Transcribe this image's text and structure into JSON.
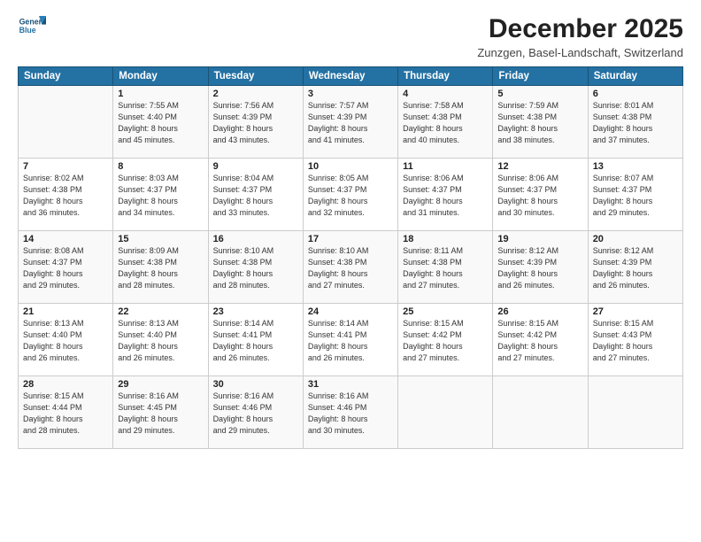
{
  "header": {
    "logo_line1": "General",
    "logo_line2": "Blue",
    "month_title": "December 2025",
    "location": "Zunzgen, Basel-Landschaft, Switzerland"
  },
  "weekdays": [
    "Sunday",
    "Monday",
    "Tuesday",
    "Wednesday",
    "Thursday",
    "Friday",
    "Saturday"
  ],
  "weeks": [
    [
      {
        "day": "",
        "info": ""
      },
      {
        "day": "1",
        "info": "Sunrise: 7:55 AM\nSunset: 4:40 PM\nDaylight: 8 hours\nand 45 minutes."
      },
      {
        "day": "2",
        "info": "Sunrise: 7:56 AM\nSunset: 4:39 PM\nDaylight: 8 hours\nand 43 minutes."
      },
      {
        "day": "3",
        "info": "Sunrise: 7:57 AM\nSunset: 4:39 PM\nDaylight: 8 hours\nand 41 minutes."
      },
      {
        "day": "4",
        "info": "Sunrise: 7:58 AM\nSunset: 4:38 PM\nDaylight: 8 hours\nand 40 minutes."
      },
      {
        "day": "5",
        "info": "Sunrise: 7:59 AM\nSunset: 4:38 PM\nDaylight: 8 hours\nand 38 minutes."
      },
      {
        "day": "6",
        "info": "Sunrise: 8:01 AM\nSunset: 4:38 PM\nDaylight: 8 hours\nand 37 minutes."
      }
    ],
    [
      {
        "day": "7",
        "info": "Sunrise: 8:02 AM\nSunset: 4:38 PM\nDaylight: 8 hours\nand 36 minutes."
      },
      {
        "day": "8",
        "info": "Sunrise: 8:03 AM\nSunset: 4:37 PM\nDaylight: 8 hours\nand 34 minutes."
      },
      {
        "day": "9",
        "info": "Sunrise: 8:04 AM\nSunset: 4:37 PM\nDaylight: 8 hours\nand 33 minutes."
      },
      {
        "day": "10",
        "info": "Sunrise: 8:05 AM\nSunset: 4:37 PM\nDaylight: 8 hours\nand 32 minutes."
      },
      {
        "day": "11",
        "info": "Sunrise: 8:06 AM\nSunset: 4:37 PM\nDaylight: 8 hours\nand 31 minutes."
      },
      {
        "day": "12",
        "info": "Sunrise: 8:06 AM\nSunset: 4:37 PM\nDaylight: 8 hours\nand 30 minutes."
      },
      {
        "day": "13",
        "info": "Sunrise: 8:07 AM\nSunset: 4:37 PM\nDaylight: 8 hours\nand 29 minutes."
      }
    ],
    [
      {
        "day": "14",
        "info": "Sunrise: 8:08 AM\nSunset: 4:37 PM\nDaylight: 8 hours\nand 29 minutes."
      },
      {
        "day": "15",
        "info": "Sunrise: 8:09 AM\nSunset: 4:38 PM\nDaylight: 8 hours\nand 28 minutes."
      },
      {
        "day": "16",
        "info": "Sunrise: 8:10 AM\nSunset: 4:38 PM\nDaylight: 8 hours\nand 28 minutes."
      },
      {
        "day": "17",
        "info": "Sunrise: 8:10 AM\nSunset: 4:38 PM\nDaylight: 8 hours\nand 27 minutes."
      },
      {
        "day": "18",
        "info": "Sunrise: 8:11 AM\nSunset: 4:38 PM\nDaylight: 8 hours\nand 27 minutes."
      },
      {
        "day": "19",
        "info": "Sunrise: 8:12 AM\nSunset: 4:39 PM\nDaylight: 8 hours\nand 26 minutes."
      },
      {
        "day": "20",
        "info": "Sunrise: 8:12 AM\nSunset: 4:39 PM\nDaylight: 8 hours\nand 26 minutes."
      }
    ],
    [
      {
        "day": "21",
        "info": "Sunrise: 8:13 AM\nSunset: 4:40 PM\nDaylight: 8 hours\nand 26 minutes."
      },
      {
        "day": "22",
        "info": "Sunrise: 8:13 AM\nSunset: 4:40 PM\nDaylight: 8 hours\nand 26 minutes."
      },
      {
        "day": "23",
        "info": "Sunrise: 8:14 AM\nSunset: 4:41 PM\nDaylight: 8 hours\nand 26 minutes."
      },
      {
        "day": "24",
        "info": "Sunrise: 8:14 AM\nSunset: 4:41 PM\nDaylight: 8 hours\nand 26 minutes."
      },
      {
        "day": "25",
        "info": "Sunrise: 8:15 AM\nSunset: 4:42 PM\nDaylight: 8 hours\nand 27 minutes."
      },
      {
        "day": "26",
        "info": "Sunrise: 8:15 AM\nSunset: 4:42 PM\nDaylight: 8 hours\nand 27 minutes."
      },
      {
        "day": "27",
        "info": "Sunrise: 8:15 AM\nSunset: 4:43 PM\nDaylight: 8 hours\nand 27 minutes."
      }
    ],
    [
      {
        "day": "28",
        "info": "Sunrise: 8:15 AM\nSunset: 4:44 PM\nDaylight: 8 hours\nand 28 minutes."
      },
      {
        "day": "29",
        "info": "Sunrise: 8:16 AM\nSunset: 4:45 PM\nDaylight: 8 hours\nand 29 minutes."
      },
      {
        "day": "30",
        "info": "Sunrise: 8:16 AM\nSunset: 4:46 PM\nDaylight: 8 hours\nand 29 minutes."
      },
      {
        "day": "31",
        "info": "Sunrise: 8:16 AM\nSunset: 4:46 PM\nDaylight: 8 hours\nand 30 minutes."
      },
      {
        "day": "",
        "info": ""
      },
      {
        "day": "",
        "info": ""
      },
      {
        "day": "",
        "info": ""
      }
    ]
  ]
}
